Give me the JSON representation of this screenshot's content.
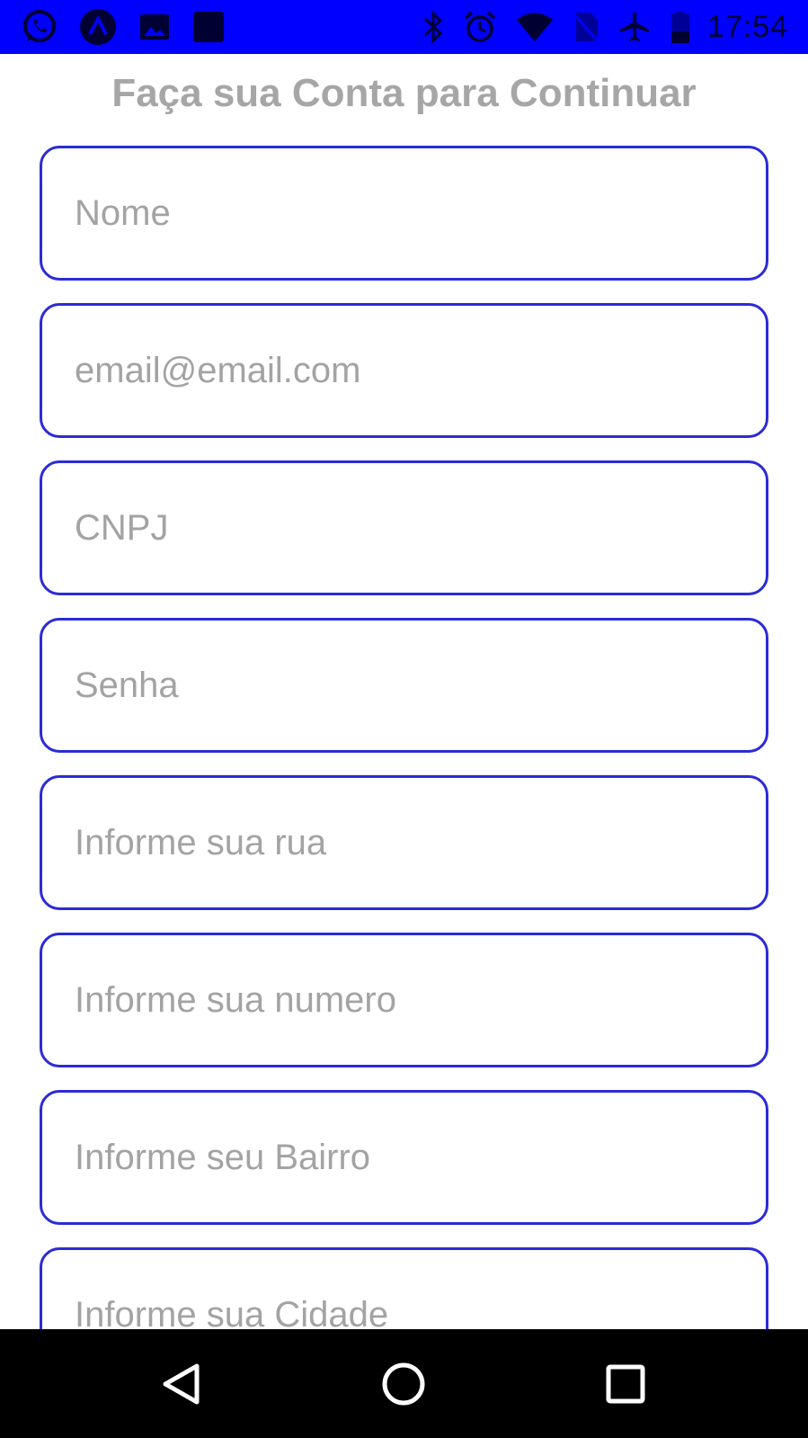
{
  "status_bar": {
    "time": "17:54",
    "left_icons": [
      "whatsapp-icon",
      "app-a-icon",
      "gallery-icon",
      "app-square-icon"
    ],
    "right_icons": [
      "bluetooth-icon",
      "alarm-icon",
      "wifi-icon",
      "no-sim-icon",
      "airplane-mode-icon",
      "battery-icon"
    ],
    "background_color": "#0000ff"
  },
  "page": {
    "title": "Faça sua Conta para Continuar"
  },
  "form": {
    "border_color": "#2b2bd6",
    "fields": [
      {
        "placeholder": "Nome",
        "value": ""
      },
      {
        "placeholder": "email@email.com",
        "value": ""
      },
      {
        "placeholder": "CNPJ",
        "value": ""
      },
      {
        "placeholder": "Senha",
        "value": ""
      },
      {
        "placeholder": "Informe sua rua",
        "value": ""
      },
      {
        "placeholder": "Informe sua numero",
        "value": ""
      },
      {
        "placeholder": "Informe seu Bairro",
        "value": ""
      },
      {
        "placeholder": "Informe sua Cidade",
        "value": ""
      }
    ]
  },
  "nav_bar": {
    "buttons": [
      "back-icon",
      "home-icon",
      "recents-icon"
    ]
  }
}
